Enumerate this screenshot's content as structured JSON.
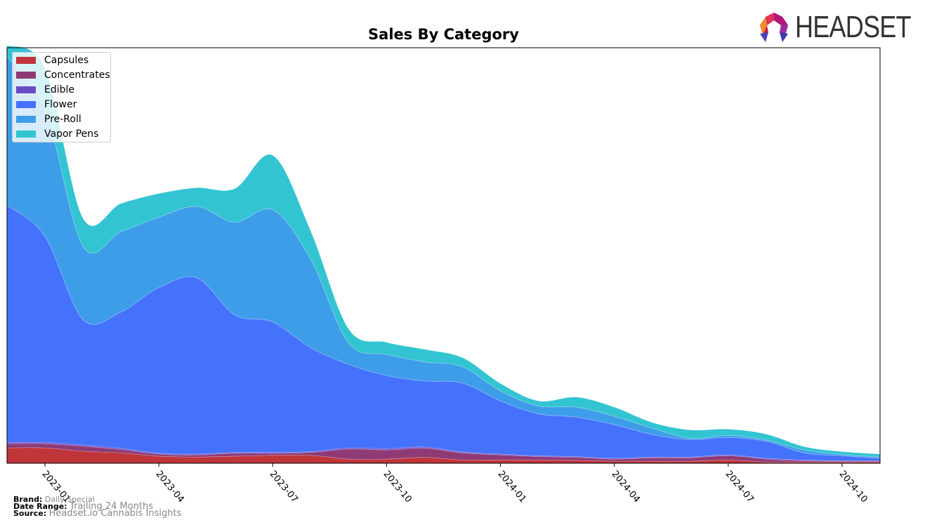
{
  "chart_data": {
    "type": "area",
    "stacked": true,
    "smooth": true,
    "title": "Sales By Category",
    "xlabel": "",
    "ylabel": "",
    "y_ticks_visible": false,
    "legend_position": "top-left",
    "x": [
      "2022-12",
      "2023-01",
      "2023-02",
      "2023-03",
      "2023-04",
      "2023-05",
      "2023-06",
      "2023-07",
      "2023-08",
      "2023-09",
      "2023-10",
      "2023-11",
      "2023-12",
      "2024-01",
      "2024-02",
      "2024-03",
      "2024-04",
      "2024-05",
      "2024-06",
      "2024-07",
      "2024-08",
      "2024-09",
      "2024-10",
      "2024-11"
    ],
    "x_tick_labels": [
      "2023-01",
      "2023-04",
      "2023-07",
      "2023-10",
      "2024-01",
      "2024-04",
      "2024-07",
      "2024-10"
    ],
    "x_tick_positions": [
      "2023-01",
      "2023-04",
      "2023-07",
      "2023-10",
      "2024-01",
      "2024-04",
      "2024-07",
      "2024-10"
    ],
    "ylim": [
      0,
      100
    ],
    "series": [
      {
        "name": "Capsules",
        "color": "#c0353a",
        "values": [
          3.7,
          3.7,
          2.9,
          2.5,
          1.7,
          1.5,
          1.7,
          1.9,
          1.9,
          1.0,
          1.0,
          1.4,
          0.8,
          0.8,
          0.8,
          0.7,
          0.5,
          0.5,
          0.5,
          0.8,
          0.3,
          0.3,
          0.3,
          0.3
        ]
      },
      {
        "name": "Concentrates",
        "color": "#8e3a75",
        "values": [
          1.0,
          1.0,
          1.2,
          0.8,
          0.5,
          0.5,
          0.7,
          0.5,
          0.7,
          2.4,
          2.2,
          2.2,
          1.7,
          1.2,
          0.8,
          0.7,
          0.5,
          0.8,
          0.8,
          1.0,
          0.7,
          0.3,
          0.2,
          0.2
        ]
      },
      {
        "name": "Edible",
        "color": "#6a4bc4",
        "values": [
          0.3,
          0.3,
          0.3,
          0.3,
          0.2,
          0.2,
          0.2,
          0.2,
          0.2,
          0.3,
          0.3,
          0.3,
          0.2,
          0.2,
          0.2,
          0.2,
          0.2,
          0.2,
          0.2,
          0.2,
          0.2,
          0.2,
          0.1,
          0.1
        ]
      },
      {
        "name": "Flower",
        "color": "#4572fd",
        "values": [
          57.1,
          49.6,
          30.2,
          32.8,
          39.9,
          42.4,
          33.1,
          31.4,
          25.0,
          20.1,
          17.6,
          15.9,
          16.6,
          12.8,
          10.1,
          9.5,
          8.1,
          5.4,
          4.2,
          4.2,
          4.1,
          1.7,
          1.2,
          0.6
        ]
      },
      {
        "name": "Pre-Roll",
        "color": "#3e9de8",
        "values": [
          35.8,
          30.8,
          17.6,
          19.3,
          16.9,
          17.2,
          22.3,
          27.0,
          21.3,
          5.1,
          5.1,
          4.6,
          3.9,
          2.4,
          1.9,
          2.4,
          2.0,
          1.5,
          0.3,
          0.5,
          0.3,
          0.7,
          0.3,
          0.3
        ]
      },
      {
        "name": "Vapor Pens",
        "color": "#33c4d2",
        "values": [
          2.7,
          9.6,
          6.8,
          6.8,
          5.7,
          4.5,
          8.1,
          13.1,
          6.8,
          3.4,
          2.9,
          3.0,
          2.2,
          1.8,
          1.2,
          2.4,
          2.2,
          1.4,
          2.0,
          1.5,
          1.4,
          0.8,
          0.7,
          0.7
        ]
      }
    ]
  },
  "legend": {
    "items": [
      {
        "label": "Capsules",
        "color": "#c0353a"
      },
      {
        "label": "Concentrates",
        "color": "#8e3a75"
      },
      {
        "label": "Edible",
        "color": "#6a4bc4"
      },
      {
        "label": "Flower",
        "color": "#4572fd"
      },
      {
        "label": "Pre-Roll",
        "color": "#3e9de8"
      },
      {
        "label": "Vapor Pens",
        "color": "#33c4d2"
      }
    ]
  },
  "logo": {
    "text": "HEADSET"
  },
  "footer": {
    "brand_label": "Brand:",
    "brand_value": "Daily Special",
    "date_range_label": "Date Range:",
    "date_range_value": "Trailing 24 Months",
    "source_label": "Source:",
    "source_value": "Headset.io Cannabis Insights"
  }
}
